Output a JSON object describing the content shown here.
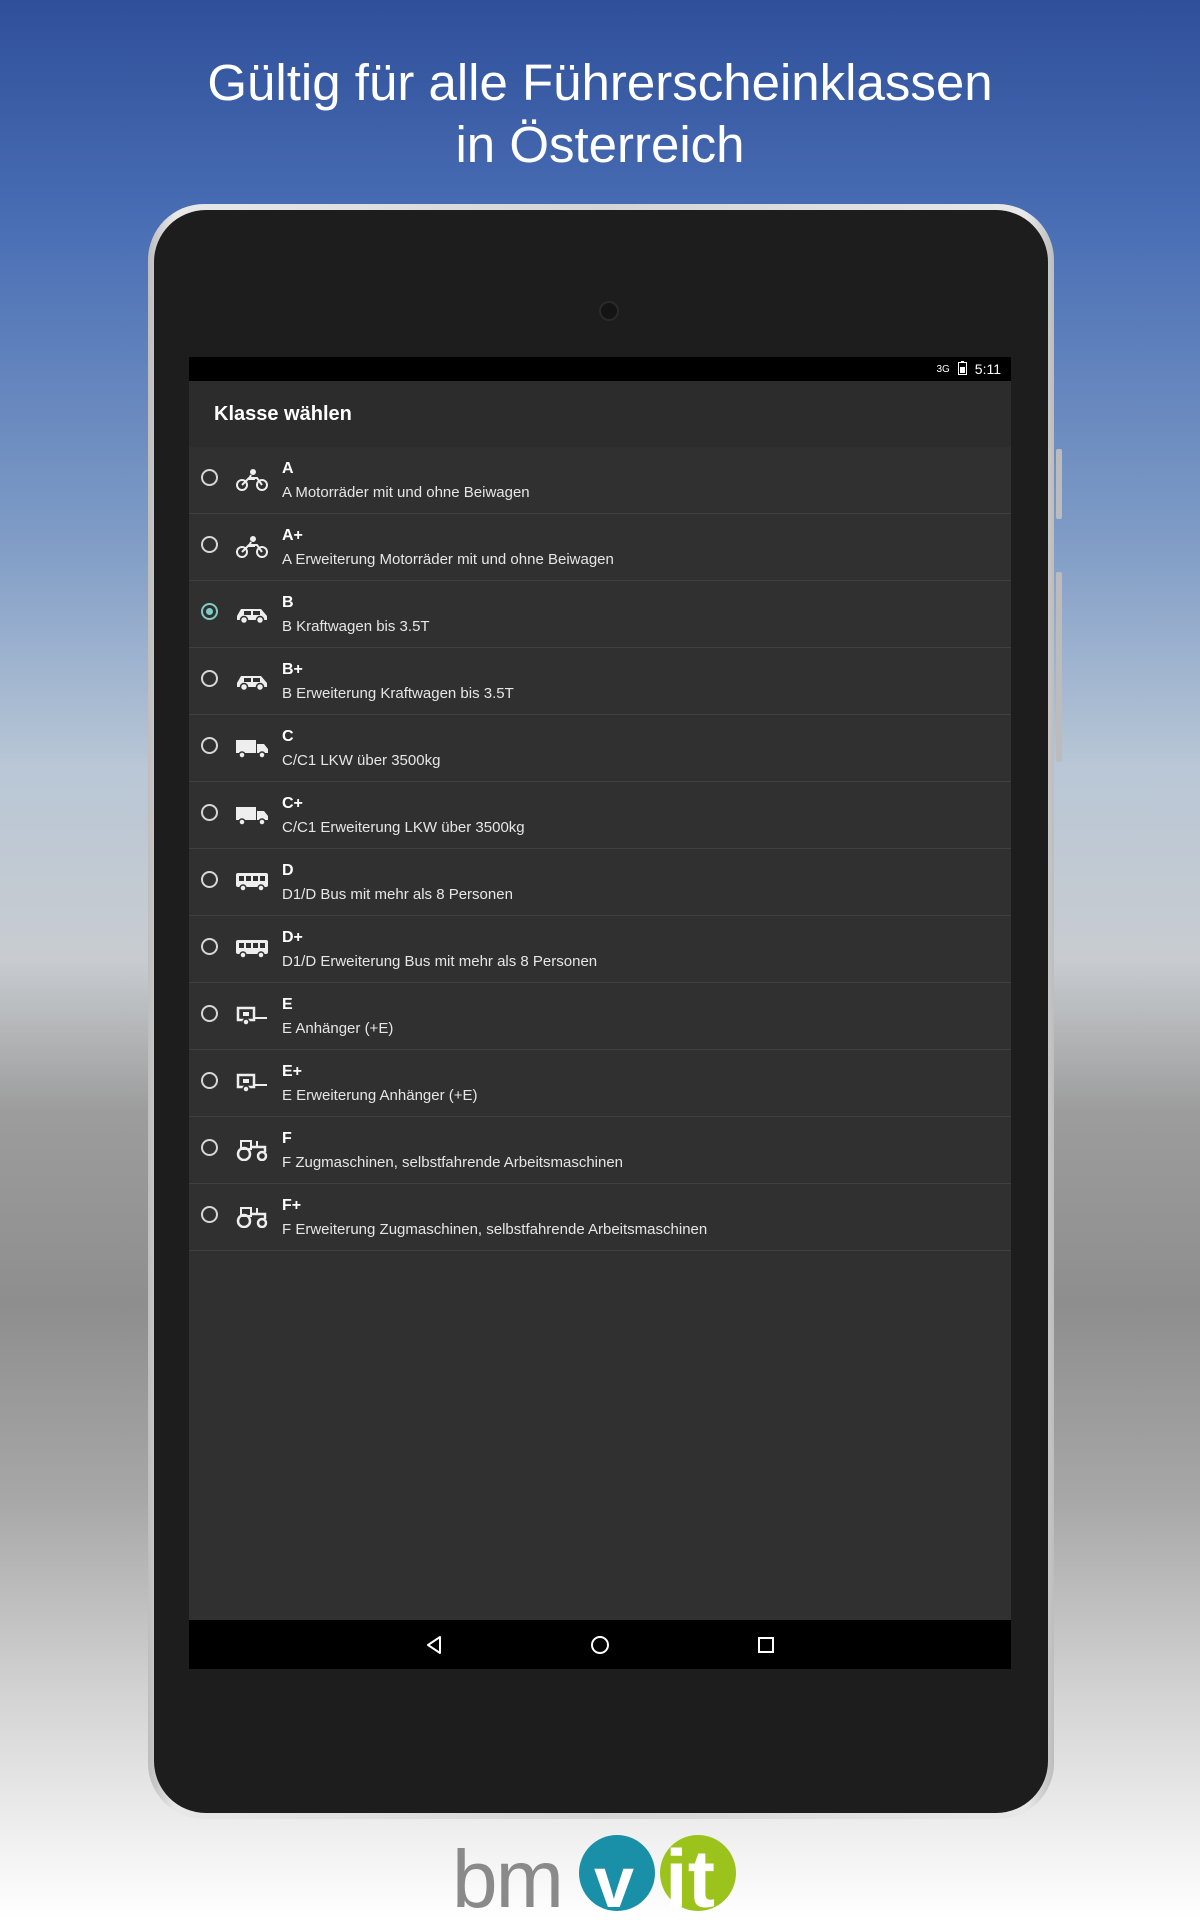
{
  "headline": {
    "line1": "Gültig für alle Führerscheinklassen",
    "line2": "in Österreich"
  },
  "statusbar": {
    "network": "3G",
    "time": "5:11"
  },
  "dialog": {
    "title": "Klasse wählen",
    "selected_index": 2,
    "items": [
      {
        "code": "A",
        "desc": "A Motorräder mit und ohne Beiwagen",
        "icon": "motorcycle-icon"
      },
      {
        "code": "A+",
        "desc": "A Erweiterung Motorräder mit und ohne Beiwagen",
        "icon": "motorcycle-icon"
      },
      {
        "code": "B",
        "desc": "B Kraftwagen bis 3.5T",
        "icon": "car-icon"
      },
      {
        "code": "B+",
        "desc": "B Erweiterung Kraftwagen bis 3.5T",
        "icon": "car-icon"
      },
      {
        "code": "C",
        "desc": "C/C1 LKW über 3500kg",
        "icon": "truck-icon"
      },
      {
        "code": "C+",
        "desc": "C/C1 Erweiterung LKW über 3500kg",
        "icon": "truck-icon"
      },
      {
        "code": "D",
        "desc": "D1/D Bus mit mehr als 8 Personen",
        "icon": "bus-icon"
      },
      {
        "code": "D+",
        "desc": "D1/D Erweiterung Bus mit mehr als 8 Personen",
        "icon": "bus-icon"
      },
      {
        "code": "E",
        "desc": "E Anhänger (+E)",
        "icon": "trailer-icon"
      },
      {
        "code": "E+",
        "desc": "E Erweiterung Anhänger (+E)",
        "icon": "trailer-icon"
      },
      {
        "code": "F",
        "desc": "F Zugmaschinen, selbstfahrende Arbeitsmaschinen",
        "icon": "tractor-icon"
      },
      {
        "code": "F+",
        "desc": "F Erweiterung Zugmaschinen, selbstfahrende Arbeitsmaschinen",
        "icon": "tractor-icon"
      }
    ]
  },
  "navbar": {
    "buttons": [
      "back-icon",
      "home-icon",
      "recents-icon"
    ]
  },
  "logo": {
    "text": "bmvit",
    "colors": {
      "grey": "#8a8a8a",
      "teal": "#1a8fa8",
      "green": "#9bc31c"
    }
  },
  "colors": {
    "accent": "#80cbc4",
    "screen_bg": "#303030",
    "title_bg": "#2c2c2c"
  }
}
